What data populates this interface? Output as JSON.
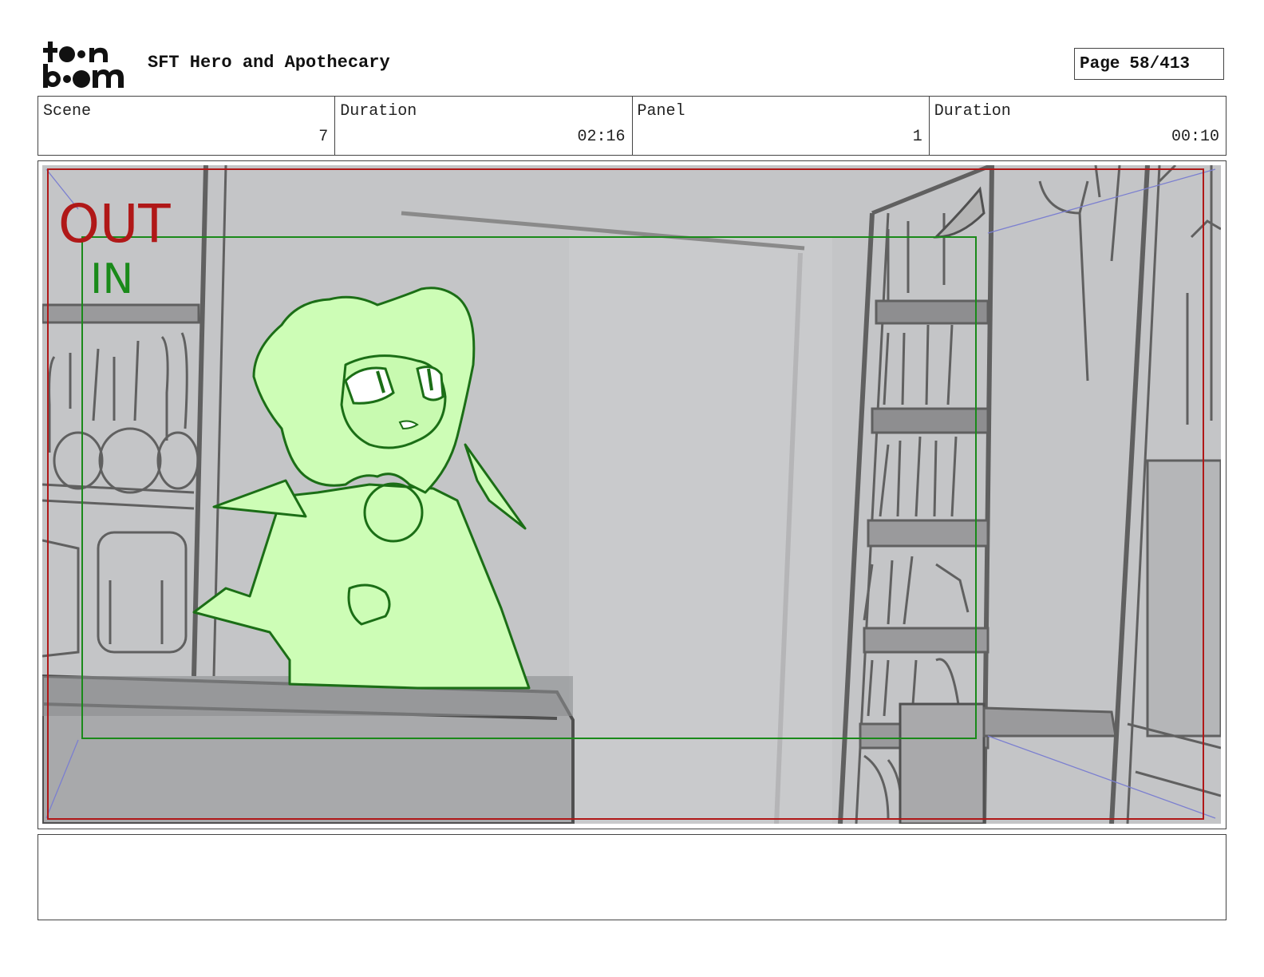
{
  "header": {
    "logo_text": "toonboom",
    "project_title": "SFT Hero and Apothecary",
    "page_label": "Page",
    "page_number": "58/413"
  },
  "info": {
    "scene_label": "Scene",
    "scene_value": "7",
    "scene_duration_label": "Duration",
    "scene_duration_value": "02:16",
    "panel_label": "Panel",
    "panel_value": "1",
    "panel_duration_label": "Duration",
    "panel_duration_value": "00:10"
  },
  "panel": {
    "out_label": "OUT",
    "in_label": "IN",
    "colors": {
      "out_frame": "#b01818",
      "in_frame": "#1a8a1a",
      "background": "#c4c5c7",
      "character_fill": "#cdfdb6",
      "character_line": "#1b6e16"
    }
  },
  "notes": {
    "text": ""
  }
}
